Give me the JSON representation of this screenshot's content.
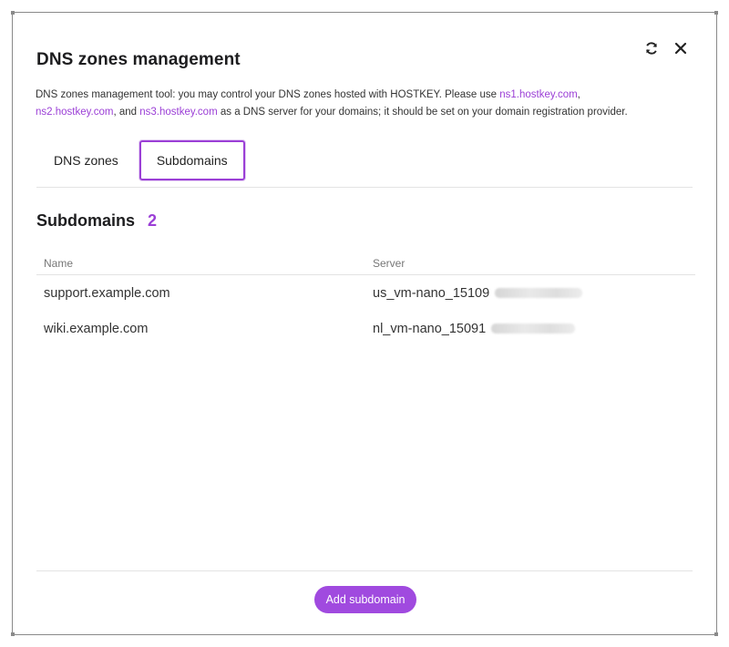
{
  "dialog": {
    "title": "DNS zones management",
    "intro": {
      "text_before": "DNS zones management tool: you may control your DNS zones hosted with HOSTKEY. Please use ",
      "ns1": "ns1.hostkey.com",
      "sep1": ", ",
      "ns2": "ns2.hostkey.com",
      "sep2": ", and ",
      "ns3": "ns3.hostkey.com",
      "text_after": " as a DNS server for your domains; it should be set on your domain registration provider."
    },
    "actions": {
      "refresh_icon": "refresh-icon",
      "close_icon": "close-icon"
    }
  },
  "tabs": [
    {
      "label": "DNS zones",
      "active": false
    },
    {
      "label": "Subdomains",
      "active": true
    }
  ],
  "section": {
    "title": "Subdomains",
    "count": "2"
  },
  "table": {
    "headers": {
      "name": "Name",
      "server": "Server"
    },
    "rows": [
      {
        "name": "support.example.com",
        "server": "us_vm-nano_15109"
      },
      {
        "name": "wiki.example.com",
        "server": "nl_vm-nano_15091"
      }
    ]
  },
  "footer": {
    "add_label": "Add subdomain"
  },
  "colors": {
    "accent": "#9b3fd6",
    "button": "#a04adf"
  }
}
